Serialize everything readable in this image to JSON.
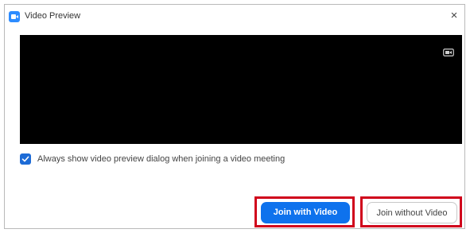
{
  "window": {
    "title": "Video Preview",
    "close_glyph": "×"
  },
  "preview": {
    "icons": [
      "zoom-logo-icon",
      "close-icon",
      "camera-settings-icon",
      "checkmark-icon"
    ]
  },
  "options": {
    "always_show_label": "Always show video preview dialog when joining a video meeting",
    "always_show_checked": true
  },
  "buttons": {
    "join_with_video": "Join with Video",
    "join_without_video": "Join without Video"
  },
  "colors": {
    "accent": "#0e72ed",
    "highlight_frame": "#d0021b",
    "preview_background": "#000000"
  }
}
